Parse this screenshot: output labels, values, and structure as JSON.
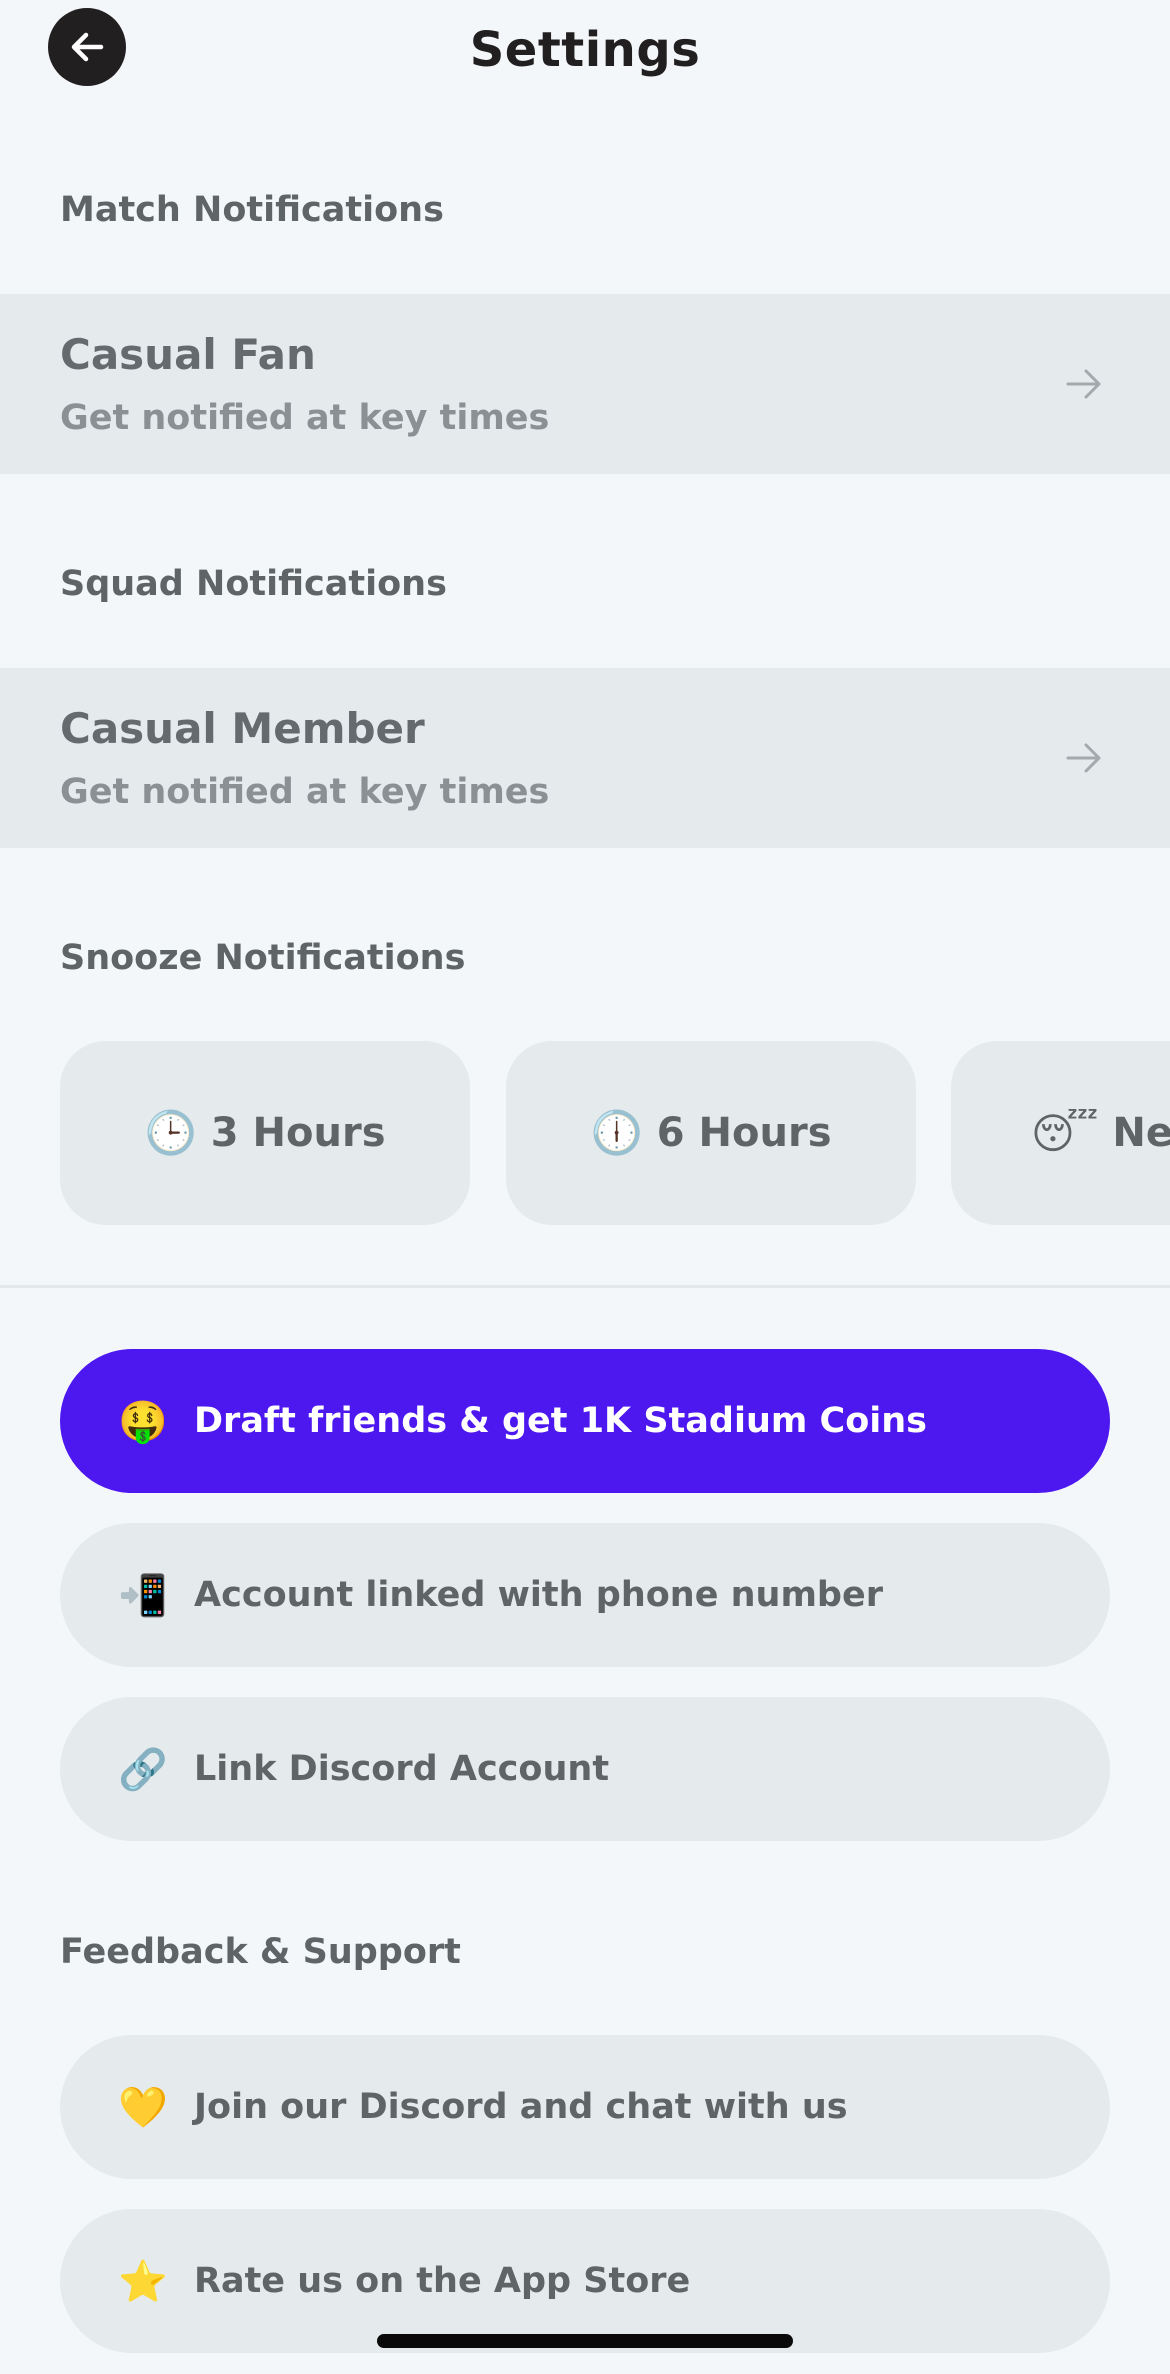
{
  "header": {
    "title": "Settings",
    "back_icon": "arrow-left-icon"
  },
  "match_notifications": {
    "label": "Match Notifications",
    "option": {
      "title": "Casual Fan",
      "subtitle": "Get notified at key times",
      "icon": "arrow-right-icon"
    }
  },
  "squad_notifications": {
    "label": "Squad Notifications",
    "option": {
      "title": "Casual Member",
      "subtitle": "Get notified at key times",
      "icon": "arrow-right-icon"
    }
  },
  "snooze": {
    "label": "Snooze Notifications",
    "options": [
      {
        "emoji": "🕒",
        "label": "3 Hours",
        "icon": "clock-icon"
      },
      {
        "emoji": "🕕",
        "label": "6 Hours",
        "icon": "clock-icon"
      },
      {
        "emoji": "😴",
        "label": "Nex",
        "icon": "sleeping-face-icon"
      }
    ]
  },
  "actions": [
    {
      "emoji": "🤑",
      "label": "Draft friends & get 1K Stadium Coins",
      "icon": "money-face-icon",
      "style": "primary"
    },
    {
      "emoji": "📲",
      "label": "Account linked with phone number",
      "icon": "phone-arrow-icon",
      "style": "secondary"
    },
    {
      "emoji": "🔗",
      "label": "Link Discord Account",
      "icon": "link-icon",
      "style": "secondary"
    }
  ],
  "feedback": {
    "label": "Feedback & Support",
    "items": [
      {
        "emoji": "💛",
        "label": "Join our Discord and chat with us",
        "icon": "yellow-heart-icon"
      },
      {
        "emoji": "⭐",
        "label": "Rate us on the App Store",
        "icon": "star-icon"
      }
    ]
  },
  "colors": {
    "background": "#f4f7fa",
    "card": "#e5eaed",
    "accent": "#4d17ef",
    "title": "#221f20",
    "text": "#5f6566"
  }
}
